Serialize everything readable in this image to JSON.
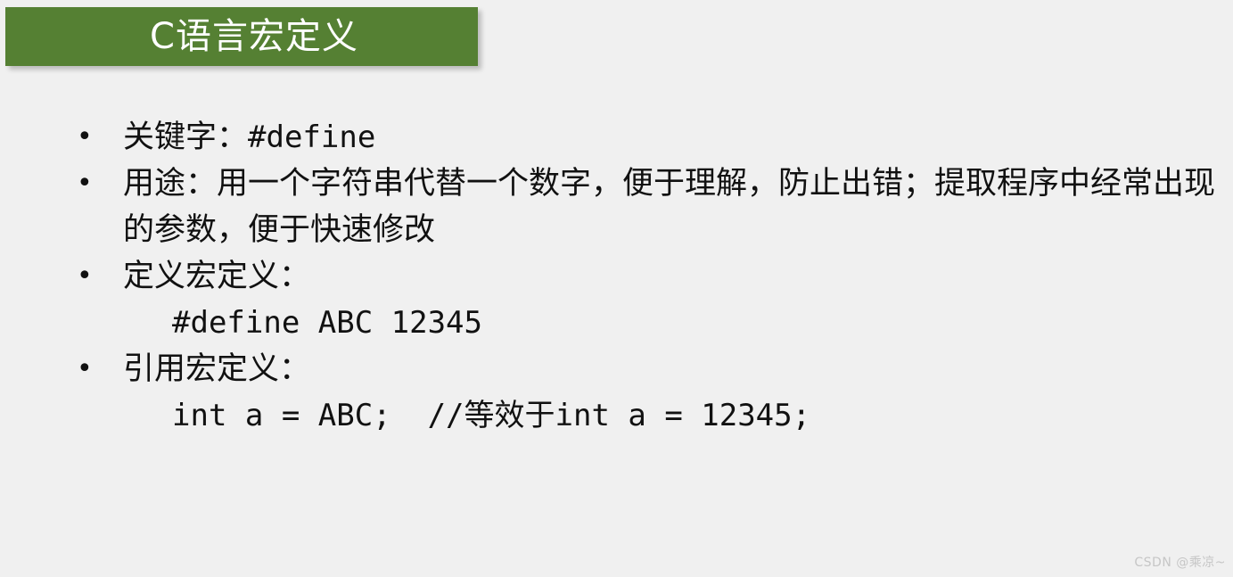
{
  "slide": {
    "background_color": "#f0f0f0",
    "title": {
      "text": "C语言宏定义",
      "banner_color": "#558033",
      "text_color": "#ffffff"
    },
    "bullet_marker": "•",
    "bullets": [
      {
        "label": "关键字：",
        "value": "#define",
        "value_is_code": true
      },
      {
        "label": "用途：用一个字符串代替一个数字，便于理解，防止出错；提取程序中经常出现的参数，便于快速修改",
        "value": "",
        "value_is_code": false
      },
      {
        "label": "定义宏定义：",
        "value": "",
        "value_is_code": false
      },
      {
        "label": "引用宏定义：",
        "value": "",
        "value_is_code": false
      }
    ],
    "code_lines": [
      "#define ABC 12345",
      "int a = ABC;  //等效于int a = 12345;"
    ]
  },
  "watermark": {
    "text": "CSDN @乘凉~",
    "color": "#c6c6c6"
  }
}
